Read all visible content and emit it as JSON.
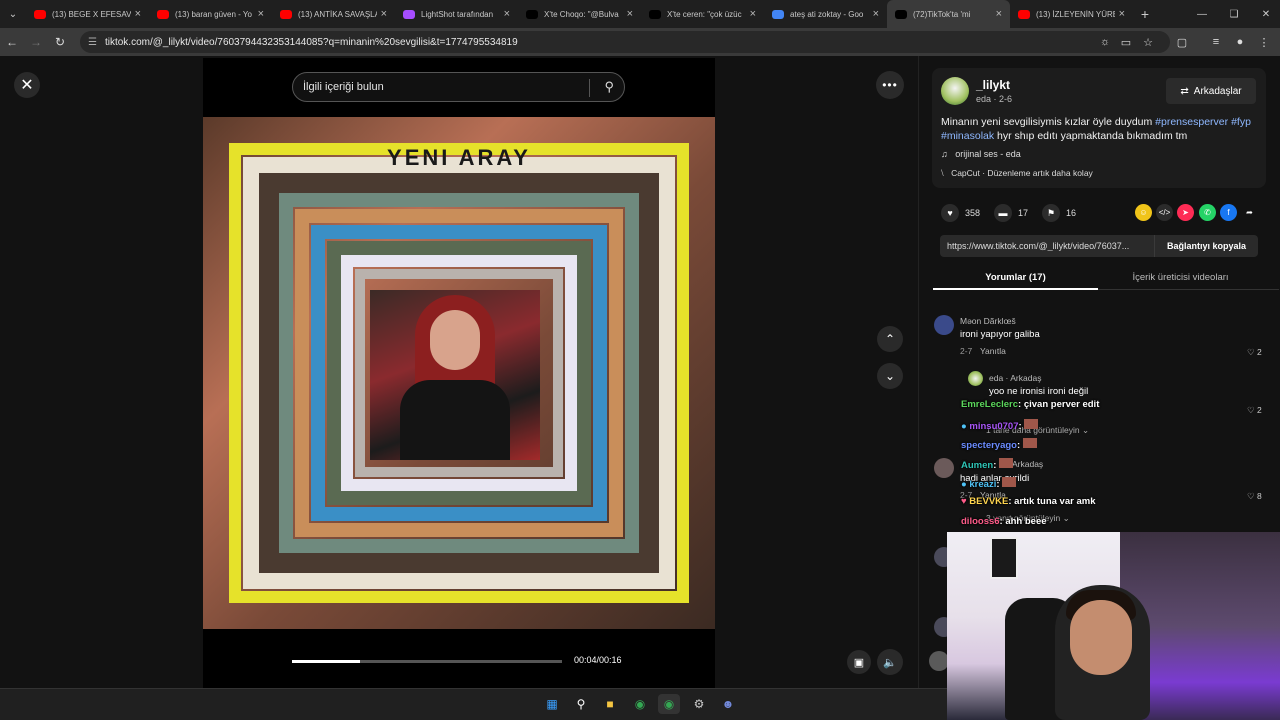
{
  "browser": {
    "tabs": [
      {
        "label": "(13) BEGE X EFESAVA",
        "icon": "youtube-icon",
        "color": "#ff0000"
      },
      {
        "label": "(13) baran güven - Yo",
        "icon": "youtube-icon",
        "color": "#ff0000"
      },
      {
        "label": "(13) ANTİKA SAVAŞLA",
        "icon": "youtube-icon",
        "color": "#ff0000"
      },
      {
        "label": "LightShot tarafından",
        "icon": "feather-icon",
        "color": "#a64dff"
      },
      {
        "label": "X'te Choqo: \"@Bulva",
        "icon": "x-icon",
        "color": "#000000"
      },
      {
        "label": "X'te ceren: \"çok üzüc",
        "icon": "x-icon",
        "color": "#000000"
      },
      {
        "label": "ateş ati zoktay - Goo",
        "icon": "google-icon",
        "color": "#4285f4"
      },
      {
        "label": "(72)TikTok'ta 'mi",
        "icon": "tiktok-icon",
        "color": "#000000",
        "active": true
      },
      {
        "label": "(13) İZLEYENİN YÜRE",
        "icon": "youtube-icon",
        "color": "#ff0000"
      }
    ],
    "url": "tiktok.com/@_lilykt/video/7603794432353144085?q=minanin%20sevgilisi&t=1774795534819"
  },
  "video": {
    "search_placeholder": "İlgili içeriği bulun",
    "time": "00:04/00:16",
    "progress": 0.25,
    "overlay_text": "YENI ARAY"
  },
  "post": {
    "username": "_lilykt",
    "meta": "eda · 2-6",
    "friends_button": "Arkadaşlar",
    "caption_text": "Minanın yeni sevgilisiymis kızlar öyle duydum",
    "tags": [
      "#prensesperver",
      "#fyp",
      "#minasolak"
    ],
    "caption_tail": "hyr shıp edıtı yapmaktanda bıkmadım tm",
    "sound": "orijinal ses - eda",
    "capcut": "CapCut · Düzenleme artık daha kolay",
    "likes": "358",
    "comments": "17",
    "saves": "16",
    "share_url": "https://www.tiktok.com/@_lilykt/video/76037...",
    "copy_link": "Bağlantıyı kopyala",
    "tab_comments": "Yorumlar (17)",
    "tab_creator": "İçerik üreticisi videoları"
  },
  "comments": [
    {
      "user": "Məon Dãrklœš",
      "text": "ironi yapıyor galiba",
      "date": "2-7",
      "reply": "Yanıtla",
      "likes": "2"
    },
    {
      "user": "eda · Arkadaş",
      "text": "yoo ne ironisi ironi değil",
      "likes": "2",
      "more": "1 tane daha görüntüleyin"
    },
    {
      "user": "Arkadaş",
      "text": "hadi anlar ayrildi",
      "date": "2-7",
      "reply": "Yanıtla",
      "likes": "8",
      "more": "3 yanıt görüntüleyin"
    }
  ],
  "chat": [
    {
      "user": "EmreLeclerc",
      "text": ": çivan perver edit",
      "color": "#5cd65c"
    },
    {
      "user": "minsu0707",
      "text": ":",
      "color": "#a855f7"
    },
    {
      "user": "specteryago",
      "text": ":",
      "color": "#6b8cff"
    },
    {
      "user": "Aumen",
      "text": ":",
      "color": "#2ec4b6"
    },
    {
      "user": "kreazi",
      "text": ":",
      "color": "#4fc3f7"
    },
    {
      "user": "BEVVKE",
      "text": ": artık tuna var amk",
      "color": "#ffd54f"
    },
    {
      "user": "dilooss6",
      "text": ": ahh beee",
      "color": "#ff5c8a"
    }
  ]
}
